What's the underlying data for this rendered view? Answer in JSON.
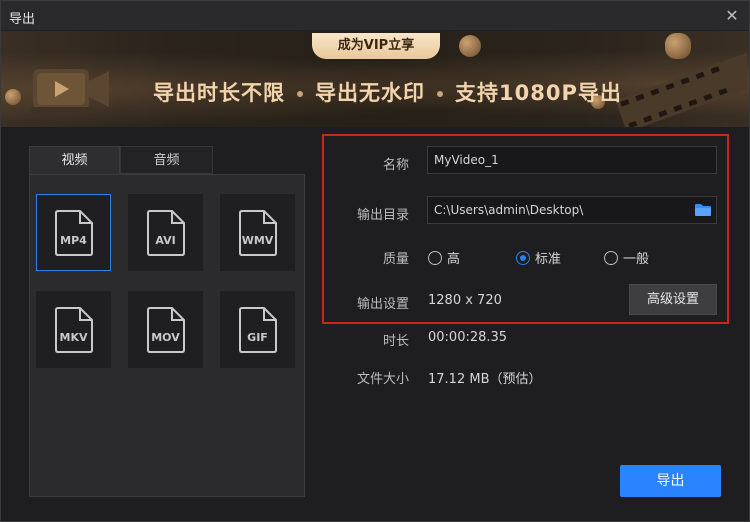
{
  "window": {
    "title": "导出"
  },
  "banner": {
    "vip_label": "成为VIP立享",
    "features": [
      "导出时长不限",
      "导出无水印",
      "支持1080P导出"
    ]
  },
  "tabs": [
    {
      "label": "视频",
      "active": true
    },
    {
      "label": "音频",
      "active": false
    }
  ],
  "formats": [
    {
      "label": "MP4",
      "selected": true
    },
    {
      "label": "AVI",
      "selected": false
    },
    {
      "label": "WMV",
      "selected": false
    },
    {
      "label": "MKV",
      "selected": false
    },
    {
      "label": "MOV",
      "selected": false
    },
    {
      "label": "GIF",
      "selected": false
    }
  ],
  "settings": {
    "name_label": "名称",
    "name_value": "MyVideo_1",
    "dir_label": "输出目录",
    "dir_value": "C:\\Users\\admin\\Desktop\\",
    "quality_label": "质量",
    "quality_options": [
      {
        "label": "高",
        "checked": false
      },
      {
        "label": "标准",
        "checked": true
      },
      {
        "label": "一般",
        "checked": false
      }
    ],
    "output_label": "输出设置",
    "output_value": "1280 x 720",
    "advanced_button": "高级设置",
    "duration_label": "时长",
    "duration_value": "00:00:28.35",
    "size_label": "文件大小",
    "size_value": "17.12 MB（预估）"
  },
  "export_button": "导出",
  "colors": {
    "accent": "#2a83ff",
    "highlight_border": "#c8281c",
    "vip_gold": "#f2d4ad"
  }
}
